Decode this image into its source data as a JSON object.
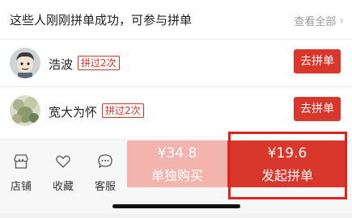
{
  "header": {
    "title": "这些人刚刚拼单成功，可参与拼单",
    "view_all": "查看全部"
  },
  "groups": [
    {
      "name": "浩波",
      "badge": "拼过2次",
      "button": "去拼单"
    },
    {
      "name": "宽大为怀",
      "badge": "拼过2次",
      "button": "去拼单"
    }
  ],
  "bottom_bar": {
    "tabs": [
      {
        "label": "店铺",
        "icon": "store-icon"
      },
      {
        "label": "收藏",
        "icon": "heart-icon"
      },
      {
        "label": "客服",
        "icon": "chat-icon"
      }
    ],
    "buy_solo": {
      "price": "¥34.8",
      "label": "单独购买"
    },
    "buy_group": {
      "price": "¥19.6",
      "label": "发起拼单"
    }
  },
  "colors": {
    "accent": "#d9362c",
    "solo_button": "#f2b4ad",
    "highlight": "#e0221c"
  }
}
